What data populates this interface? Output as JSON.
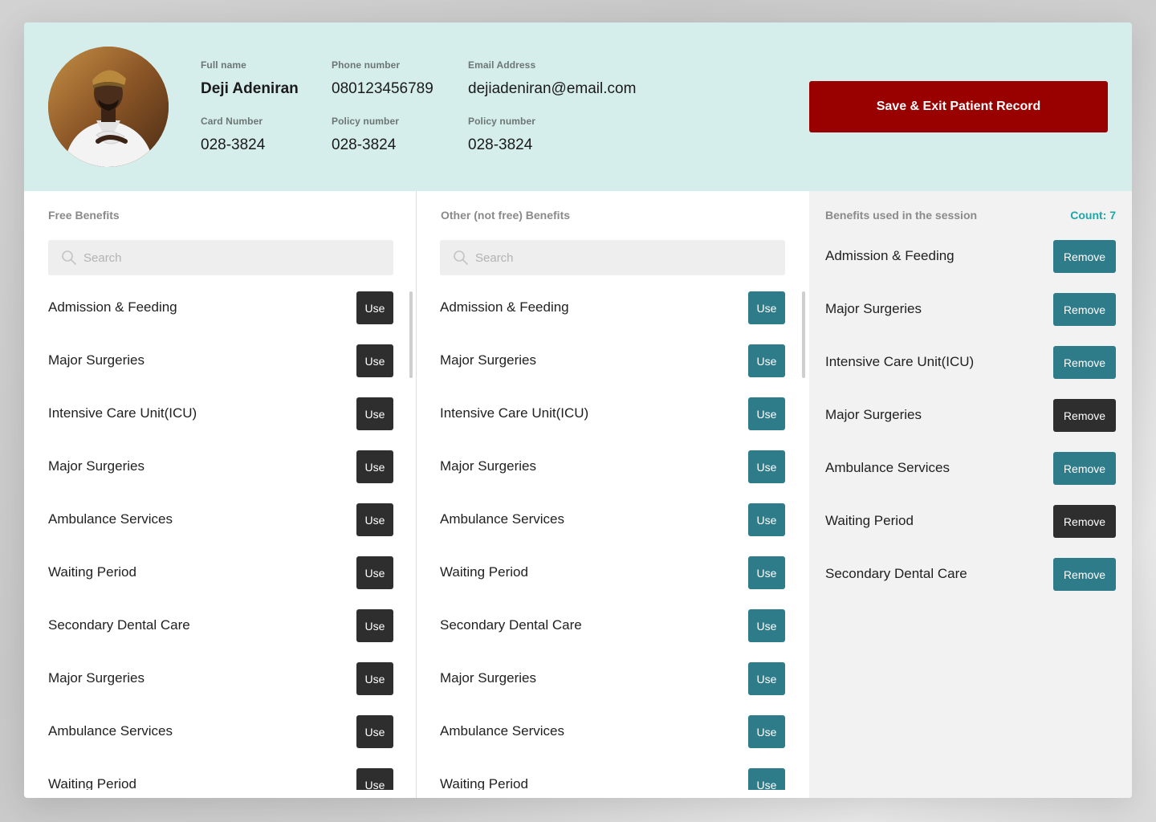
{
  "profile": {
    "full_name_label": "Full name",
    "full_name": "Deji Adeniran",
    "phone_label": "Phone number",
    "phone": "080123456789",
    "email_label": "Email Address",
    "email": "dejiadeniran@email.com",
    "card_label": "Card Number",
    "card": "028-3824",
    "policy_label_1": "Policy number",
    "policy_1": "028-3824",
    "policy_label_2": "Policy number",
    "policy_2": "028-3824",
    "save_label": "Save & Exit Patient Record"
  },
  "free": {
    "title": "Free Benefits",
    "search_placeholder": "Search",
    "use_label": "Use",
    "items": [
      "Admission & Feeding",
      "Major Surgeries",
      "Intensive Care Unit(ICU)",
      "Major Surgeries",
      "Ambulance Services",
      "Waiting Period",
      "Secondary Dental Care",
      "Major Surgeries",
      "Ambulance Services",
      "Waiting Period"
    ]
  },
  "other": {
    "title": "Other (not free) Benefits",
    "search_placeholder": "Search",
    "use_label": "Use",
    "items": [
      "Admission & Feeding",
      "Major Surgeries",
      "Intensive Care Unit(ICU)",
      "Major Surgeries",
      "Ambulance Services",
      "Waiting Period",
      "Secondary Dental Care",
      "Major Surgeries",
      "Ambulance Services",
      "Waiting Period"
    ]
  },
  "used": {
    "title": "Benefits used in the session",
    "count_label": "Count: 7",
    "remove_label": "Remove",
    "items": [
      {
        "name": "Admission & Feeding",
        "variant": "teal"
      },
      {
        "name": "Major Surgeries",
        "variant": "teal"
      },
      {
        "name": "Intensive Care Unit(ICU)",
        "variant": "teal"
      },
      {
        "name": "Major Surgeries",
        "variant": "dark"
      },
      {
        "name": "Ambulance Services",
        "variant": "teal"
      },
      {
        "name": "Waiting Period",
        "variant": "dark"
      },
      {
        "name": "Secondary Dental Care",
        "variant": "teal"
      }
    ]
  },
  "colors": {
    "header_bg": "#d5eeeb",
    "save_button": "#990000",
    "use_dark": "#2e2e2e",
    "use_teal": "#2e7b8a",
    "count": "#1aa7a7"
  },
  "icons": {
    "search": "search-icon",
    "avatar": "avatar"
  }
}
